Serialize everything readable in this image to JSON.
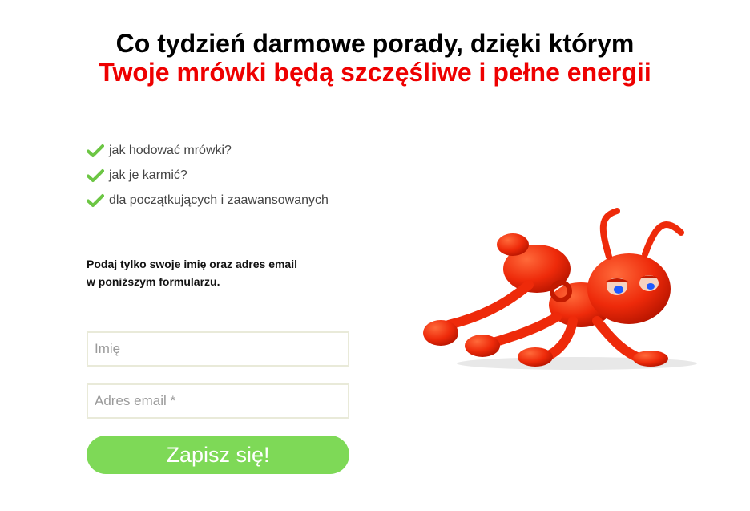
{
  "headline": {
    "line1": "Co tydzień darmowe porady, dzięki którym",
    "line2": "Twoje mrówki będą szczęśliwe i pełne energii"
  },
  "benefits": [
    {
      "text": "jak hodować mrówki?",
      "icon": "check-icon"
    },
    {
      "text": "jak je karmić?",
      "icon": "check-icon"
    },
    {
      "text": "dla początkujących i zaawansowanych",
      "icon": "check-icon"
    }
  ],
  "instructions": {
    "line1": "Podaj tylko swoje imię oraz adres email",
    "line2": "w poniższym formularzu."
  },
  "form": {
    "name_placeholder": "Imię",
    "name_value": "",
    "email_placeholder": "Adres email *",
    "email_value": "",
    "submit_label": "Zapisz się!"
  },
  "colors": {
    "headline_accent": "#ee0000",
    "check": "#6cc644",
    "button": "#7ed957",
    "field_border": "#e9ead9"
  },
  "illustration": {
    "icon": "red-ant-cartoon-illustration"
  }
}
